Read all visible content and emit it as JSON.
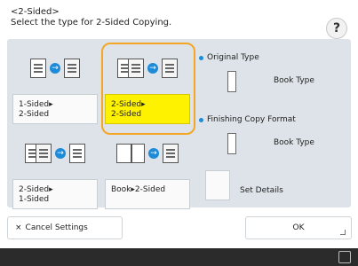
{
  "header": {
    "title_line1": "<2-Sided>",
    "title_line2": "Select the type for 2-Sided Copying.",
    "help_label": "?"
  },
  "options": {
    "one_to_two": {
      "line1": "1-Sided▸",
      "line2": "2-Sided"
    },
    "two_to_two": {
      "line1": "2-Sided▸",
      "line2": "2-Sided"
    },
    "two_to_one": {
      "line1": "2-Sided▸",
      "line2": "1-Sided"
    },
    "book_to_two": {
      "line1": "Book▸2-Sided"
    }
  },
  "side": {
    "original_type_heading": "Original Type",
    "original_type_value": "Book Type",
    "finishing_heading": "Finishing Copy Format",
    "finishing_value": "Book Type",
    "set_details_label": "Set Details"
  },
  "buttons": {
    "cancel_label": "Cancel Settings",
    "cancel_icon": "×",
    "ok_label": "OK"
  }
}
